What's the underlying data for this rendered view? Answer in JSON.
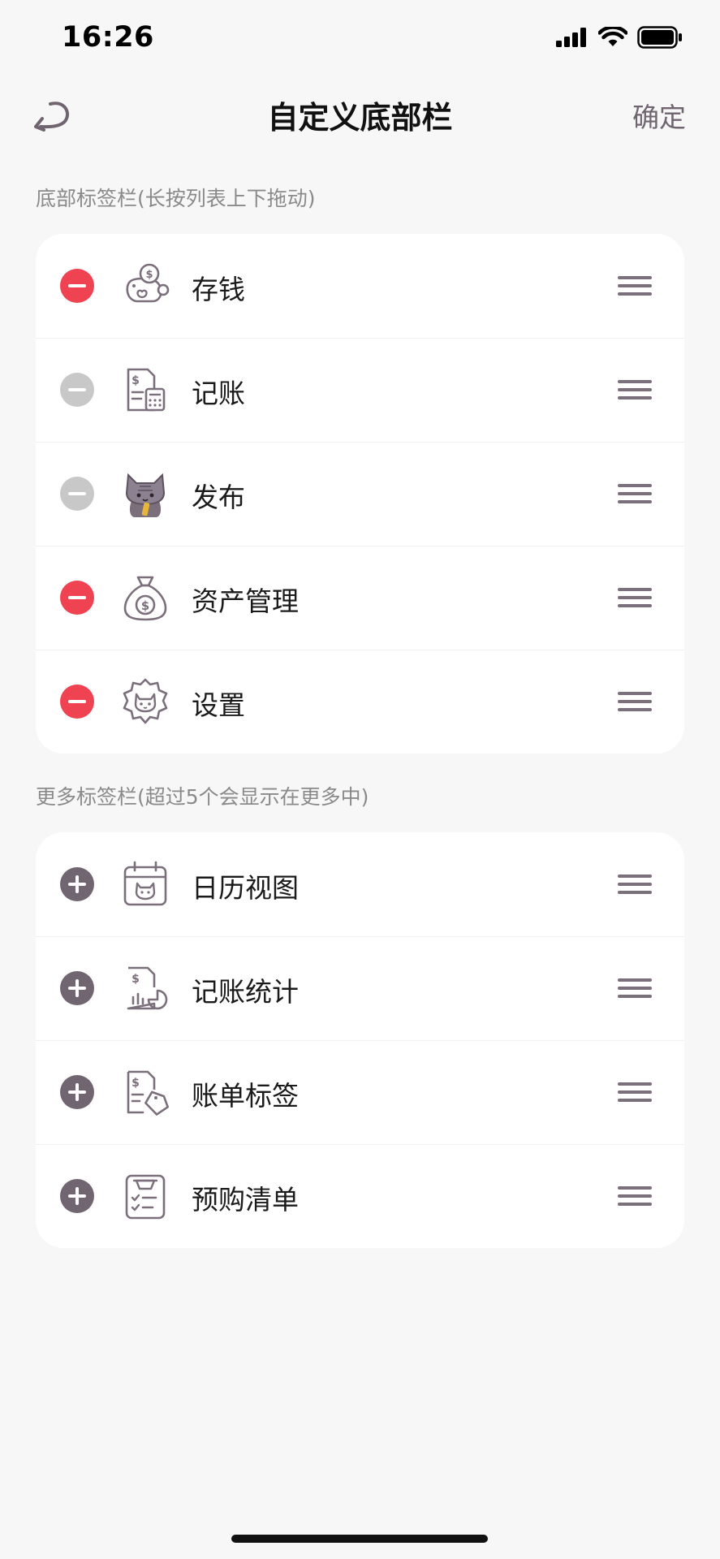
{
  "status_bar": {
    "time": "16:26",
    "icons": [
      "signal-icon",
      "wifi-icon",
      "battery-icon"
    ]
  },
  "nav": {
    "back_icon": "back-arrow-icon",
    "title": "自定义底部栏",
    "confirm_label": "确定"
  },
  "bottom_tabs": {
    "section_title": "底部标签栏(长按列表上下拖动)",
    "items": [
      {
        "label": "存钱",
        "icon": "piggy-money-icon",
        "action": "remove"
      },
      {
        "label": "记账",
        "icon": "bill-calculator-icon",
        "action": "remove-disabled"
      },
      {
        "label": "发布",
        "icon": "cat-mascot-icon",
        "action": "remove-disabled"
      },
      {
        "label": "资产管理",
        "icon": "money-bag-icon",
        "action": "remove"
      },
      {
        "label": "设置",
        "icon": "cat-gear-icon",
        "action": "remove"
      }
    ]
  },
  "more_tabs": {
    "section_title": "更多标签栏(超过5个会显示在更多中)",
    "items": [
      {
        "label": "日历视图",
        "icon": "cat-calendar-icon",
        "action": "add"
      },
      {
        "label": "记账统计",
        "icon": "bill-chart-icon",
        "action": "add"
      },
      {
        "label": "账单标签",
        "icon": "bill-tag-icon",
        "action": "add"
      },
      {
        "label": "预购清单",
        "icon": "shopping-checklist-icon",
        "action": "add"
      }
    ]
  },
  "colors": {
    "remove": "#f04352",
    "remove_disabled": "#c8c8c8",
    "add": "#706570",
    "accent": "#6f6470",
    "background": "#f7f7f7"
  }
}
